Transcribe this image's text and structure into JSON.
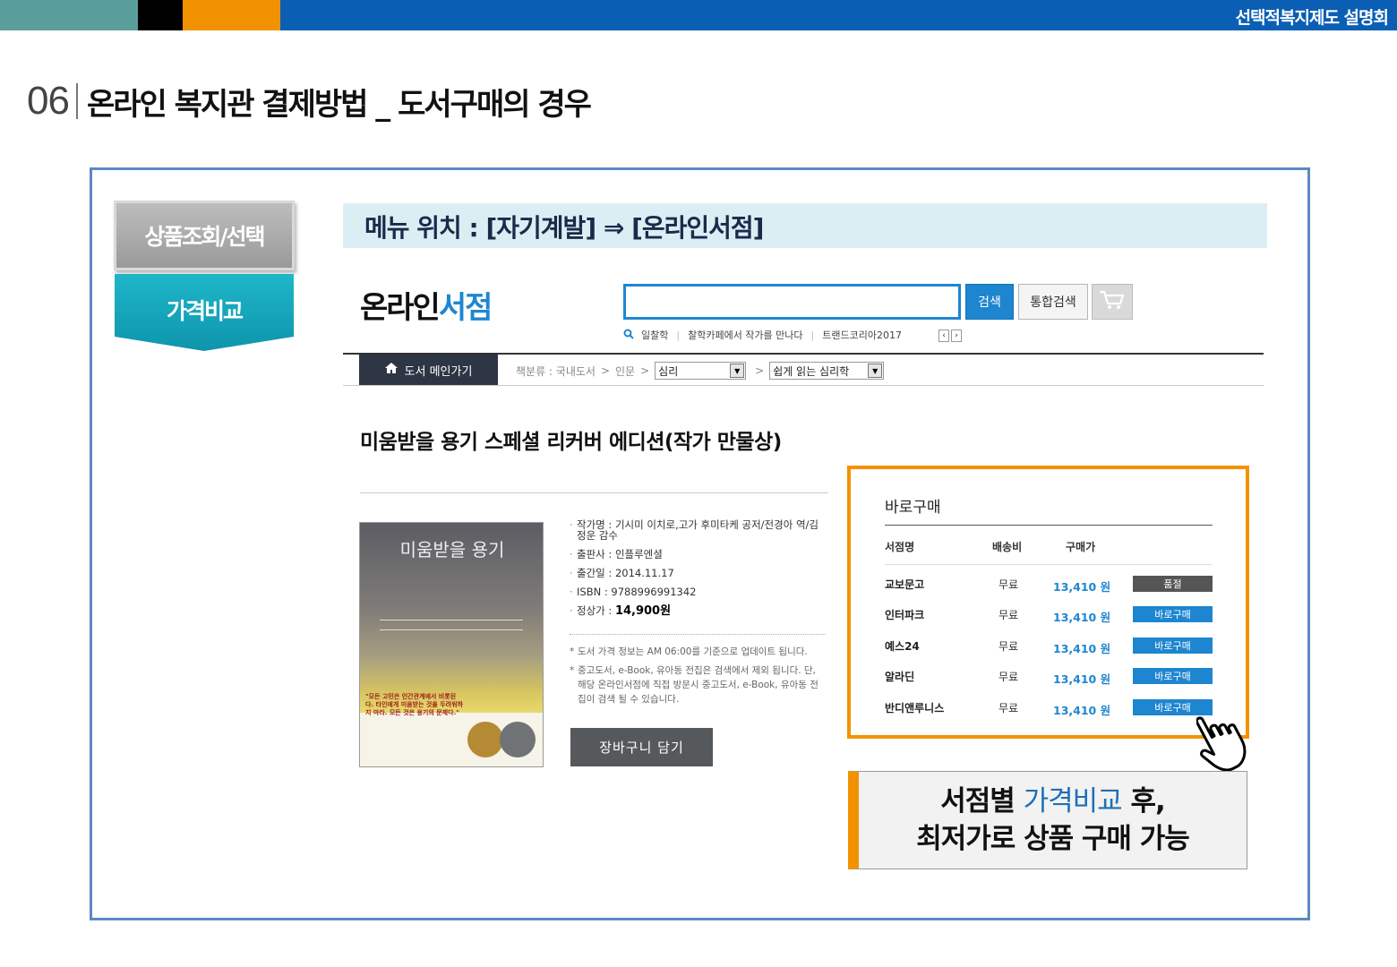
{
  "header": {
    "presentation_title": "선택적복지제도 설명회"
  },
  "slide": {
    "number": "06",
    "title": "온라인 복지관 결제방법 _ 도서구매의 경우"
  },
  "steps": {
    "step1": "상품조회/선택",
    "step2": "가격비교"
  },
  "menu_location": "메뉴 위치 : [자기계발] ⇒ [온라인서점]",
  "store": {
    "logo_part1": "온라인",
    "logo_part2": "서점",
    "search_value": "",
    "search_button": "검색",
    "all_search_button": "통합검색",
    "keywords": [
      "일찰학",
      "찰학카페에서 작가를 만나다",
      "트랜드코리아2017"
    ]
  },
  "nav": {
    "home_label": "도서 메인가기",
    "breadcrumb_prefix": "책분류 : 국내도서",
    "breadcrumb_2": "인문",
    "select_1": "심리",
    "select_2": "쉽게 읽는 심리학"
  },
  "book": {
    "title": "미움받을 용기 스페셜 리커버 에디션(작가 만물상)",
    "cover_title": "미움받을 용기",
    "cover_quote": "\"모든 고민은 인간관계에서 비롯된다. 타인에게 미움받는 것을 두려워하지 마라. 모든 것은 용기의 문제다.\"",
    "author_label": "작가명 :",
    "author": "기시미 이치로,고가 후미타케 공저/전경아 역/김정운 감수",
    "publisher_label": "출판사 :",
    "publisher": "인플루엔셜",
    "date_label": "출간일 :",
    "date": "2014.11.17",
    "isbn_label": "ISBN :",
    "isbn": "9788996991342",
    "price_label": "정상가 :",
    "price": "14,900원",
    "note1": "도서 가격 정보는 AM 06:00를 기준으로 업데이트 됩니다.",
    "note2": "중고도서, e-Book, 유아동 전집은 검색에서 제외 됩니다. 단, 해당 온라인서점에 직접 방문시 중고도서, e-Book, 유아동 전집이 검색 될 수 있습니다.",
    "basket_button": "장바구니 담기"
  },
  "purchase": {
    "title": "바로구매",
    "col_store": "서점명",
    "col_shipping": "배송비",
    "col_price": "구매가",
    "rows": [
      {
        "store": "교보문고",
        "shipping": "무료",
        "price": "13,410 원",
        "button": "품절"
      },
      {
        "store": "인터파크",
        "shipping": "무료",
        "price": "13,410 원",
        "button": "바로구매"
      },
      {
        "store": "예스24",
        "shipping": "무료",
        "price": "13,410 원",
        "button": "바로구매"
      },
      {
        "store": "알라딘",
        "shipping": "무료",
        "price": "13,410 원",
        "button": "바로구매"
      },
      {
        "store": "반디앤루니스",
        "shipping": "무료",
        "price": "13,410 원",
        "button": "바로구매"
      }
    ]
  },
  "callout": {
    "line1_a": "서점별 ",
    "line1_b": "가격비교",
    "line1_c": " 후,",
    "line2": "최저가로 상품 구매 가능"
  }
}
